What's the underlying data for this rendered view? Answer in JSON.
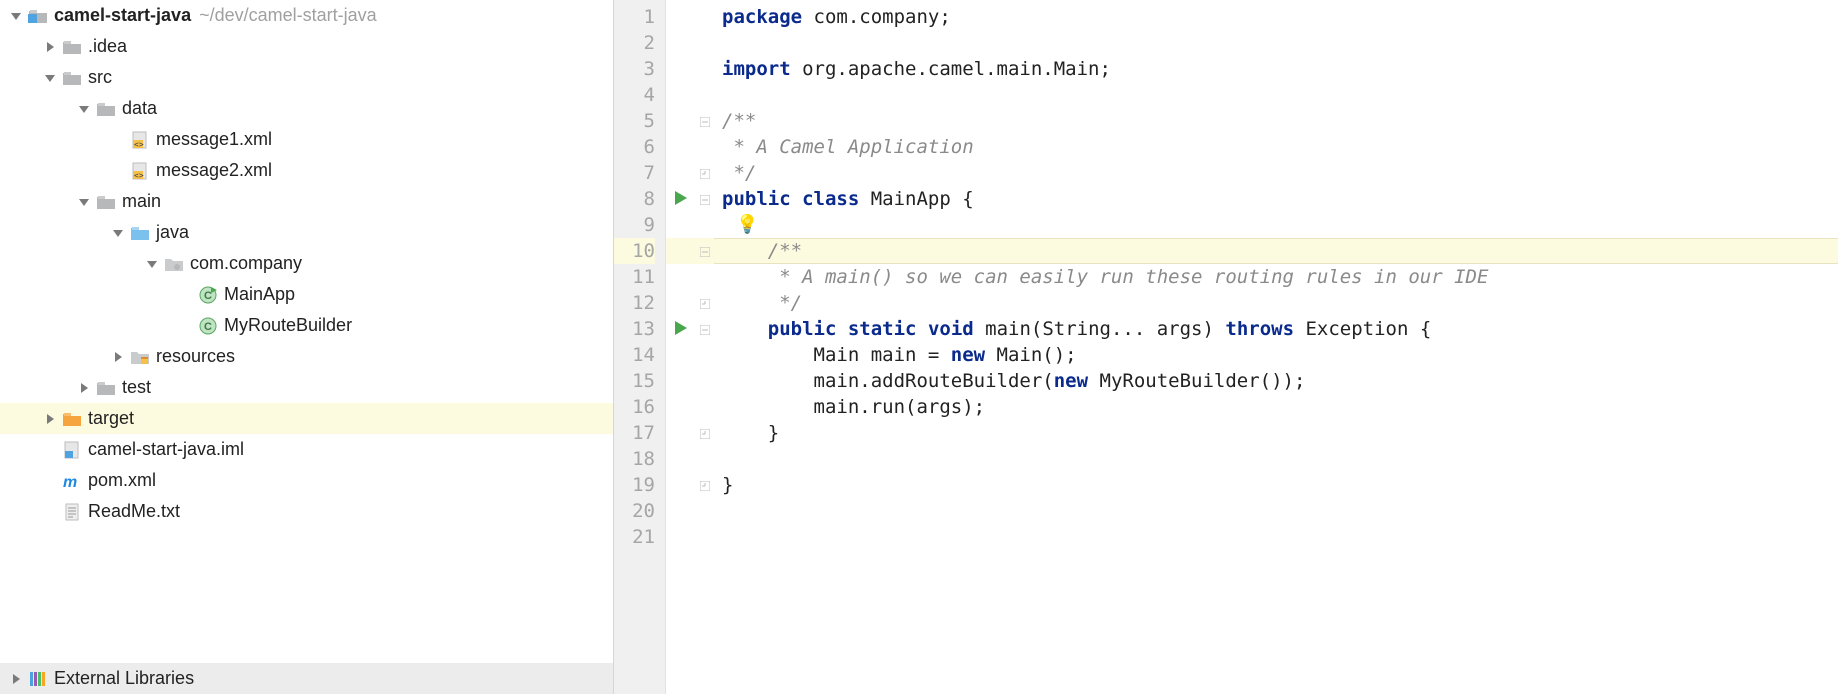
{
  "path_hint": "~/dev/camel-start-java",
  "project_tree": [
    {
      "depth": 0,
      "arrow": "down",
      "icon": "module",
      "label": "camel-start-java",
      "bold": true,
      "hint": "~/dev/camel-start-java"
    },
    {
      "depth": 1,
      "arrow": "right",
      "icon": "folder",
      "label": ".idea"
    },
    {
      "depth": 1,
      "arrow": "down",
      "icon": "folder",
      "label": "src"
    },
    {
      "depth": 2,
      "arrow": "down",
      "icon": "folder",
      "label": "data"
    },
    {
      "depth": 3,
      "arrow": "",
      "icon": "xml",
      "label": "message1.xml"
    },
    {
      "depth": 3,
      "arrow": "",
      "icon": "xml",
      "label": "message2.xml"
    },
    {
      "depth": 2,
      "arrow": "down",
      "icon": "folder",
      "label": "main"
    },
    {
      "depth": 3,
      "arrow": "down",
      "icon": "folder-blue",
      "label": "java"
    },
    {
      "depth": 4,
      "arrow": "down",
      "icon": "package",
      "label": "com.company"
    },
    {
      "depth": 5,
      "arrow": "",
      "icon": "class-run",
      "label": "MainApp"
    },
    {
      "depth": 5,
      "arrow": "",
      "icon": "class",
      "label": "MyRouteBuilder"
    },
    {
      "depth": 3,
      "arrow": "right",
      "icon": "resources",
      "label": "resources"
    },
    {
      "depth": 2,
      "arrow": "right",
      "icon": "folder",
      "label": "test"
    },
    {
      "depth": 1,
      "arrow": "right",
      "icon": "folder-orange",
      "label": "target",
      "selected": true
    },
    {
      "depth": 1,
      "arrow": "",
      "icon": "iml",
      "label": "camel-start-java.iml"
    },
    {
      "depth": 1,
      "arrow": "",
      "icon": "maven",
      "label": "pom.xml"
    },
    {
      "depth": 1,
      "arrow": "",
      "icon": "text",
      "label": "ReadMe.txt"
    }
  ],
  "external_libs_label": "External Libraries",
  "editor": {
    "highlight_line": 10,
    "run_marks": [
      8,
      13
    ],
    "fold_marks": {
      "5": "open",
      "7": "close",
      "8": "open",
      "10": "open",
      "12": "close",
      "13": "open",
      "17": "close",
      "19": "close"
    },
    "bulb_line": 9,
    "lines": [
      {
        "n": 1,
        "tokens": [
          [
            "kw",
            "package"
          ],
          [
            "pl",
            " com.company;"
          ]
        ]
      },
      {
        "n": 2,
        "tokens": []
      },
      {
        "n": 3,
        "tokens": [
          [
            "kw",
            "import"
          ],
          [
            "pl",
            " org.apache.camel.main.Main;"
          ]
        ]
      },
      {
        "n": 4,
        "tokens": []
      },
      {
        "n": 5,
        "tokens": [
          [
            "cm",
            "/**"
          ]
        ]
      },
      {
        "n": 6,
        "tokens": [
          [
            "cm",
            " * A Camel Application"
          ]
        ]
      },
      {
        "n": 7,
        "tokens": [
          [
            "cm",
            " */"
          ]
        ]
      },
      {
        "n": 8,
        "tokens": [
          [
            "kw",
            "public"
          ],
          [
            "pl",
            " "
          ],
          [
            "kw",
            "class"
          ],
          [
            "pl",
            " MainApp {"
          ]
        ]
      },
      {
        "n": 9,
        "tokens": []
      },
      {
        "n": 10,
        "tokens": [
          [
            "pl",
            "    "
          ],
          [
            "cm",
            "/**"
          ]
        ]
      },
      {
        "n": 11,
        "tokens": [
          [
            "pl",
            "    "
          ],
          [
            "cm",
            " * A main() so we can easily run these routing rules in our IDE"
          ]
        ]
      },
      {
        "n": 12,
        "tokens": [
          [
            "pl",
            "    "
          ],
          [
            "cm",
            " */"
          ]
        ]
      },
      {
        "n": 13,
        "tokens": [
          [
            "pl",
            "    "
          ],
          [
            "kw",
            "public"
          ],
          [
            "pl",
            " "
          ],
          [
            "kw",
            "static"
          ],
          [
            "pl",
            " "
          ],
          [
            "kw",
            "void"
          ],
          [
            "pl",
            " main(String... args) "
          ],
          [
            "kw",
            "throws"
          ],
          [
            "pl",
            " Exception {"
          ]
        ]
      },
      {
        "n": 14,
        "tokens": [
          [
            "pl",
            "        Main main = "
          ],
          [
            "kw",
            "new"
          ],
          [
            "pl",
            " Main();"
          ]
        ]
      },
      {
        "n": 15,
        "tokens": [
          [
            "pl",
            "        main.addRouteBuilder("
          ],
          [
            "kw",
            "new"
          ],
          [
            "pl",
            " MyRouteBuilder());"
          ]
        ]
      },
      {
        "n": 16,
        "tokens": [
          [
            "pl",
            "        main.run(args);"
          ]
        ]
      },
      {
        "n": 17,
        "tokens": [
          [
            "pl",
            "    }"
          ]
        ]
      },
      {
        "n": 18,
        "tokens": []
      },
      {
        "n": 19,
        "tokens": [
          [
            "pl",
            "}"
          ]
        ]
      },
      {
        "n": 20,
        "tokens": []
      },
      {
        "n": 21,
        "tokens": []
      }
    ]
  }
}
